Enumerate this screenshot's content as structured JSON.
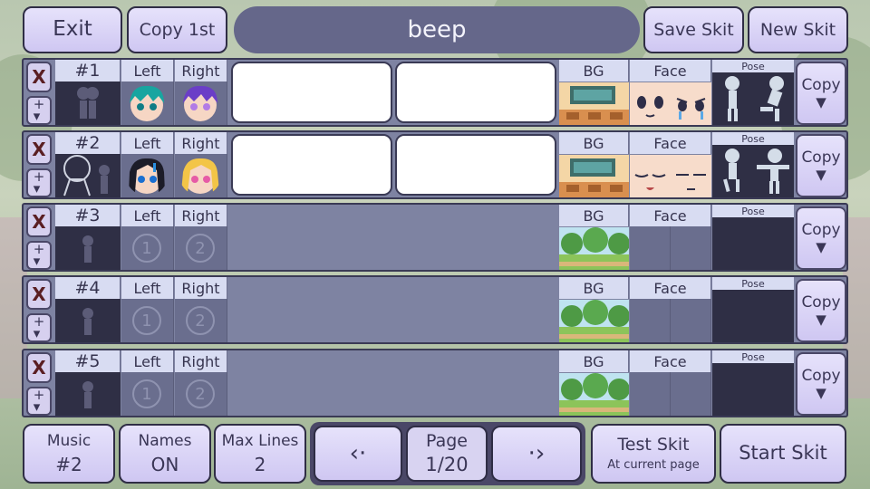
{
  "top": {
    "exit_label": "Exit",
    "copy_first_label": "Copy 1st",
    "skit_title": "beep",
    "save_label": "Save Skit",
    "new_label": "New Skit"
  },
  "columns": {
    "left": "Left",
    "right": "Right",
    "bg": "BG",
    "face": "Face",
    "pose": "Pose",
    "copy": "Copy",
    "delete": "X"
  },
  "rows": [
    {
      "number": "#1",
      "filled": true
    },
    {
      "number": "#2",
      "filled": true
    },
    {
      "number": "#3",
      "filled": false
    },
    {
      "number": "#4",
      "filled": false
    },
    {
      "number": "#5",
      "filled": false
    }
  ],
  "slots": {
    "one": "1",
    "two": "2"
  },
  "bottom": {
    "music_label": "Music",
    "music_value": "#2",
    "names_label": "Names",
    "names_value": "ON",
    "maxlines_label": "Max Lines",
    "maxlines_value": "2",
    "page_label": "Page",
    "page_value": "1/20",
    "test_label": "Test Skit",
    "test_sub": "At current page",
    "start_label": "Start Skit"
  },
  "icons": {
    "prev": "chevron-left-icon",
    "next": "chevron-right-icon",
    "move": "move-up-down-icon",
    "copy_arrow": "triangle-down-icon"
  },
  "colors": {
    "button_fill": "#d6cff3",
    "row_fill": "#7e83a2",
    "title_bar": "#65678a",
    "delete_x": "#5a1e22"
  }
}
